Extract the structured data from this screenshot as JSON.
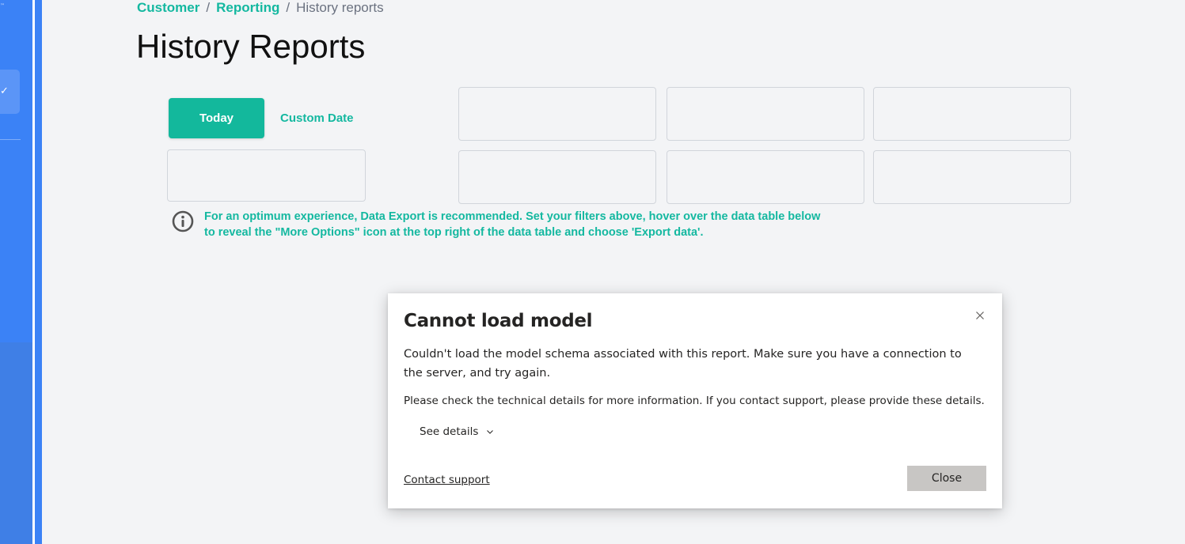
{
  "breadcrumb": {
    "items": [
      "Customer",
      "Reporting"
    ],
    "separator": "/",
    "current": "History reports"
  },
  "page_title": "History Reports",
  "date_filter": {
    "today_label": "Today",
    "custom_date_label": "Custom Date"
  },
  "info_icon": "info-circle-icon",
  "info_message": "For an optimum experience, Data Export is recommended. Set your filters above, hover over the data table below to reveal the \"More Options\" icon at the top right of the data table and choose 'Export data'.",
  "dialog": {
    "title": "Cannot load model",
    "message": "Couldn't load the model schema associated with this report. Make sure you have a connection to the server, and try again.",
    "help_text": "Please check the technical details for more information. If you contact support, please provide these details.",
    "see_details_label": "See details",
    "contact_support_label": "Contact support",
    "close_label": "Close",
    "close_icon": "close-icon",
    "chevron_icon": "chevron-down-icon"
  },
  "colors": {
    "accent": "#14b8a0",
    "sidebar": "#3b82f6",
    "page_background": "#f3f4f6",
    "close_button": "#c8c6c4"
  }
}
